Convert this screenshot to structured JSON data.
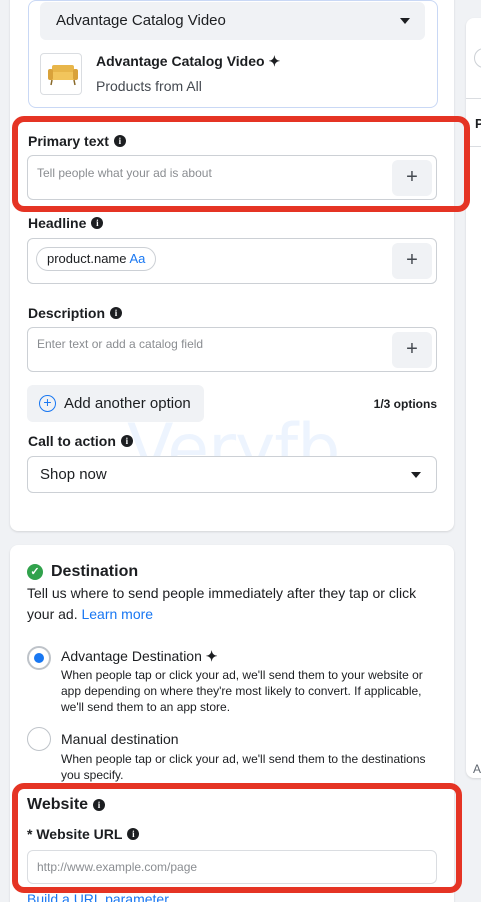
{
  "catalog": {
    "selected": "Advantage Catalog Video",
    "item_title": "Advantage Catalog Video",
    "sparkle": "✦",
    "item_subtitle": "Products from All"
  },
  "primary_text": {
    "label": "Primary text",
    "placeholder": "Tell people what your ad is about",
    "plus": "+"
  },
  "headline": {
    "label": "Headline",
    "chip_text": "product.name",
    "chip_suffix": "Aa",
    "plus": "+"
  },
  "description": {
    "label": "Description",
    "placeholder": "Enter text or add a catalog field",
    "plus": "+"
  },
  "add_option": {
    "label": "Add another option",
    "count": "1/3 options"
  },
  "cta": {
    "label": "Call to action",
    "selected": "Shop now"
  },
  "watermark": "Veryfb",
  "destination": {
    "title": "Destination",
    "description": "Tell us where to send people immediately after they tap or click your ad.",
    "learn_more": "Learn more",
    "options": [
      {
        "title": "Advantage Destination",
        "sparkle": "✦",
        "description": "When people tap or click your ad, we'll send them to your website or app depending on where they're most likely to convert. If applicable, we'll send them to an app store.",
        "selected": true
      },
      {
        "title": "Manual destination",
        "description": "When people tap or click your ad, we'll send them to the destinations you specify.",
        "selected": false
      }
    ]
  },
  "website": {
    "title": "Website",
    "url_label": "* Website URL",
    "url_placeholder": "http://www.example.com/page",
    "build_link": "Build a URL parameter"
  },
  "right_panel": {
    "letter_p": "P",
    "letter_a": "A"
  },
  "colors": {
    "highlight": "#e53424",
    "link": "#1877f2",
    "success": "#31a24c"
  }
}
